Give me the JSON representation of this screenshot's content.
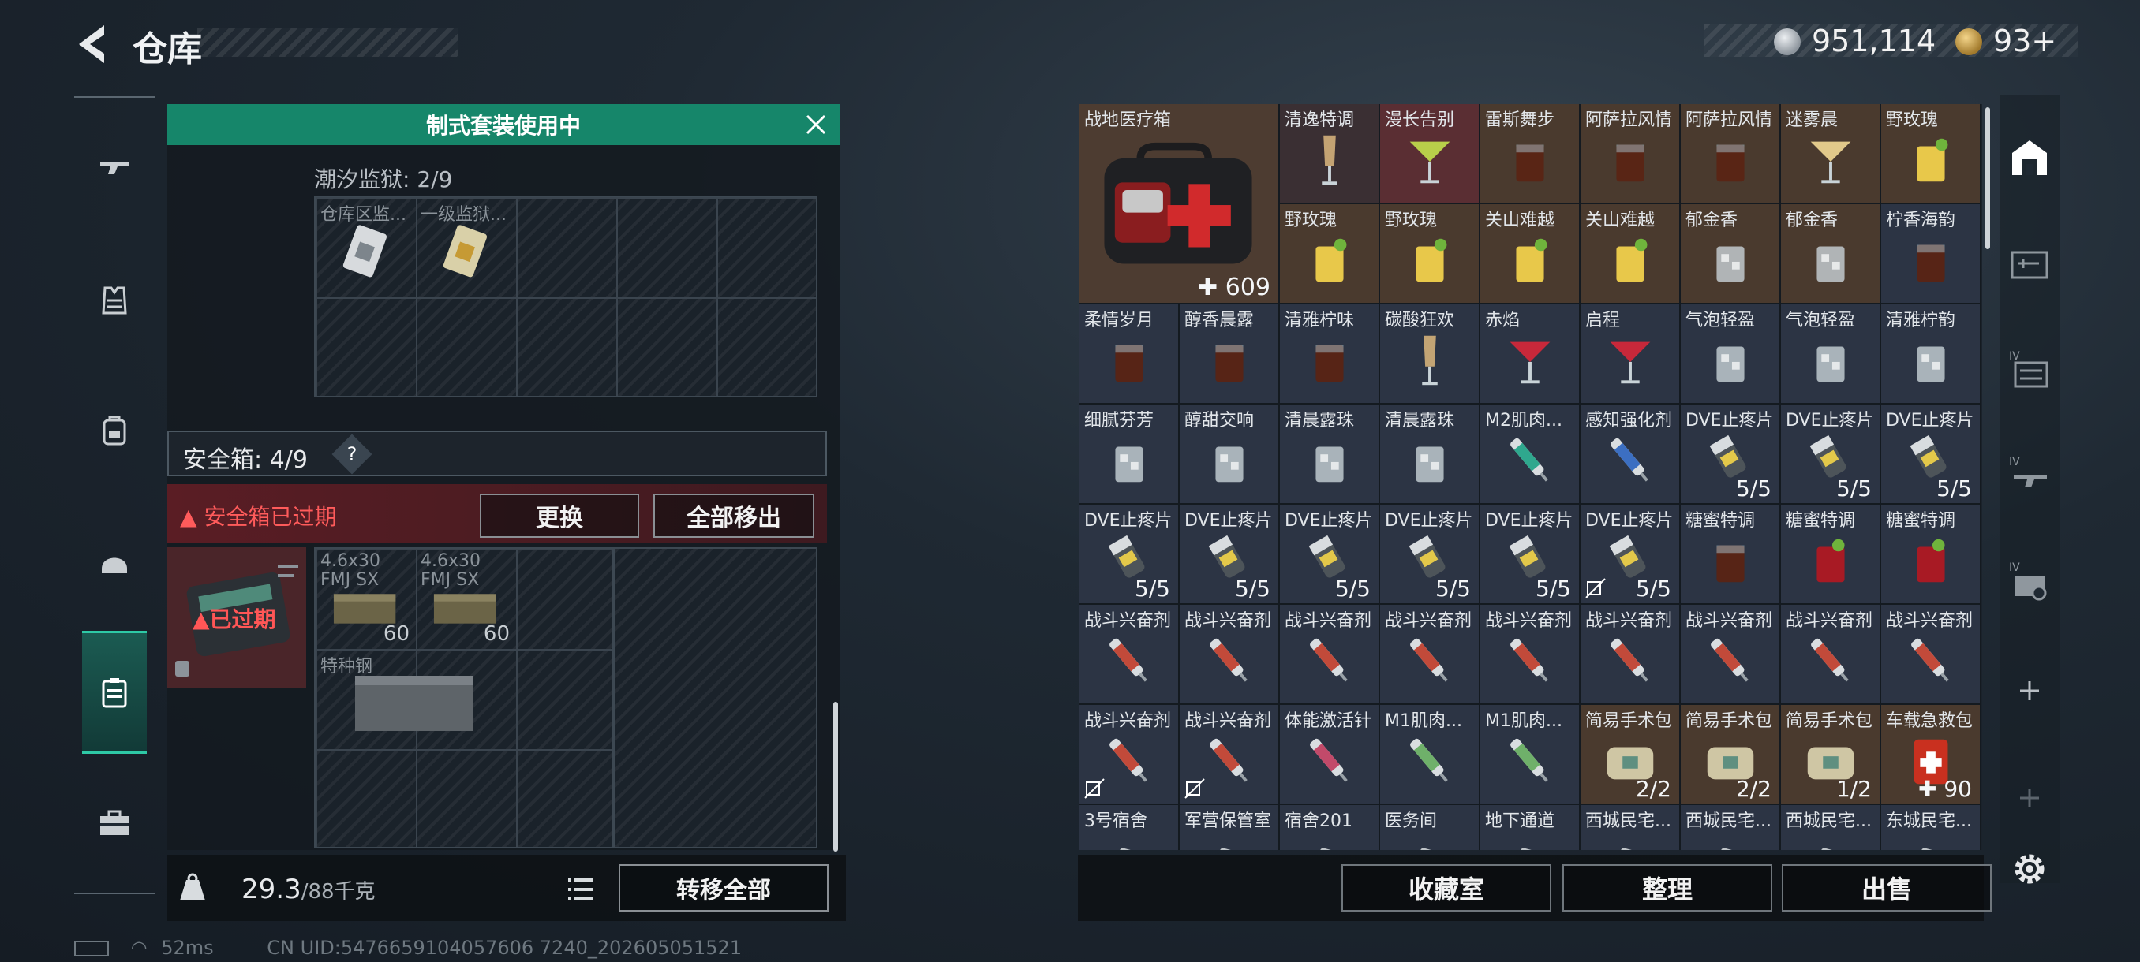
{
  "header": {
    "title": "仓库",
    "currency_silver": "951,114",
    "currency_gold": "93+"
  },
  "left_nav": [
    "gun-icon",
    "armor-vest-icon",
    "backpack-icon",
    "helmet-icon",
    "safebox-icon",
    "toolbox-icon"
  ],
  "kit": {
    "banner": "制式套装使用中",
    "container_label": "潮汐监狱: 2/9",
    "items": [
      {
        "name": "仓库区监...",
        "icon": "keycard-icon"
      },
      {
        "name": "一级监狱...",
        "icon": "keycard-icon"
      }
    ]
  },
  "safebox": {
    "label": "安全箱: 4/9",
    "help": "?",
    "expired_warning": "安全箱已过期",
    "replace_button": "更换",
    "move_all_button": "全部移出",
    "case_status": "已过期",
    "items": [
      {
        "name": "4.6x30 FMJ SX",
        "count": "60"
      },
      {
        "name": "4.6x30 FMJ SX",
        "count": "60"
      },
      {
        "name": "特种钢",
        "count": ""
      }
    ]
  },
  "footer_left": {
    "weight": "29.3",
    "weight_max": "/88千克",
    "transfer_all": "转移全部"
  },
  "inventory": {
    "featured": {
      "name": "战地医疗箱",
      "count": "609"
    },
    "cells": [
      {
        "name": "清逸特调",
        "count": "",
        "color": "#3a2f33",
        "kind": "champagne"
      },
      {
        "name": "漫长告别",
        "count": "",
        "color": "#5a2e33",
        "kind": "martini"
      },
      {
        "name": "雷斯舞步",
        "count": "",
        "color": "#4a3a2e",
        "kind": "cola"
      },
      {
        "name": "阿萨拉风情",
        "count": "",
        "color": "#4a3a2e",
        "kind": "cola"
      },
      {
        "name": "阿萨拉风情",
        "count": "",
        "color": "#4a3a2e",
        "kind": "cola"
      },
      {
        "name": "迷雾晨",
        "count": "",
        "color": "#4a3a2e",
        "kind": "coupe"
      },
      {
        "name": "野玫瑰",
        "count": "",
        "color": "#4a3a2e",
        "kind": "yellow"
      },
      {
        "name": "野玫瑰",
        "count": "",
        "color": "#4a3a2e",
        "kind": "yellow"
      },
      {
        "name": "野玫瑰",
        "count": "",
        "color": "#4a3a2e",
        "kind": "yellow"
      },
      {
        "name": "关山难越",
        "count": "",
        "color": "#4a3a2e",
        "kind": "yellow"
      },
      {
        "name": "关山难越",
        "count": "",
        "color": "#4a3a2e",
        "kind": "yellow"
      },
      {
        "name": "郁金香",
        "count": "",
        "color": "#4a3a2e",
        "kind": "clear"
      },
      {
        "name": "郁金香",
        "count": "",
        "color": "#4a3a2e",
        "kind": "clear"
      },
      {
        "name": "柠香海韵",
        "count": "",
        "color": "#2c3444",
        "kind": "cola"
      },
      {
        "name": "柔情岁月",
        "count": "",
        "color": "#2c3444",
        "kind": "whisky"
      },
      {
        "name": "醇香晨露",
        "count": "",
        "color": "#2c3444",
        "kind": "whisky"
      },
      {
        "name": "清雅柠味",
        "count": "",
        "color": "#2c3444",
        "kind": "whisky"
      },
      {
        "name": "碳酸狂欢",
        "count": "",
        "color": "#2c3444",
        "kind": "champagne"
      },
      {
        "name": "赤焰",
        "count": "",
        "color": "#2c3444",
        "kind": "martini-red"
      },
      {
        "name": "启程",
        "count": "",
        "color": "#2c3444",
        "kind": "martini-red"
      },
      {
        "name": "气泡轻盈",
        "count": "",
        "color": "#2c3444",
        "kind": "ice"
      },
      {
        "name": "气泡轻盈",
        "count": "",
        "color": "#2c3444",
        "kind": "ice"
      },
      {
        "name": "清雅柠韵",
        "count": "",
        "color": "#2c3444",
        "kind": "ice"
      },
      {
        "name": "细腻芬芳",
        "count": "",
        "color": "#2c3444",
        "kind": "ice"
      },
      {
        "name": "醇甜交响",
        "count": "",
        "color": "#2c3444",
        "kind": "ice"
      },
      {
        "name": "清晨露珠",
        "count": "",
        "color": "#2c3444",
        "kind": "ice"
      },
      {
        "name": "清晨露珠",
        "count": "",
        "color": "#2c3444",
        "kind": "ice"
      },
      {
        "name": "M2肌肉...",
        "count": "",
        "color": "#2c3444",
        "kind": "syringe-teal"
      },
      {
        "name": "感知强化剂",
        "count": "",
        "color": "#2c3444",
        "kind": "syringe-blue"
      },
      {
        "name": "DVE止疼片",
        "count": "5/5",
        "color": "#2c3444",
        "kind": "pills"
      },
      {
        "name": "DVE止疼片",
        "count": "5/5",
        "color": "#2c3444",
        "kind": "pills"
      },
      {
        "name": "DVE止疼片",
        "count": "5/5",
        "color": "#2c3444",
        "kind": "pills"
      },
      {
        "name": "DVE止疼片",
        "count": "5/5",
        "color": "#2c3444",
        "kind": "pills"
      },
      {
        "name": "DVE止疼片",
        "count": "5/5",
        "color": "#2c3444",
        "kind": "pills"
      },
      {
        "name": "DVE止疼片",
        "count": "5/5",
        "color": "#2c3444",
        "kind": "pills"
      },
      {
        "name": "DVE止疼片",
        "count": "5/5",
        "color": "#2c3444",
        "kind": "pills"
      },
      {
        "name": "DVE止疼片",
        "count": "5/5",
        "color": "#2c3444",
        "kind": "pills"
      },
      {
        "name": "DVE止疼片",
        "count": "5/5",
        "color": "#2c3444",
        "kind": "pills",
        "locked": true
      },
      {
        "name": "糖蜜特调",
        "count": "",
        "color": "#2c3444",
        "kind": "whisky"
      },
      {
        "name": "糖蜜特调",
        "count": "",
        "color": "#2c3444",
        "kind": "ice-red"
      },
      {
        "name": "糖蜜特调",
        "count": "",
        "color": "#2c3444",
        "kind": "ice-red"
      },
      {
        "name": "战斗兴奋剂",
        "count": "",
        "color": "#2c3444",
        "kind": "syringe-red"
      },
      {
        "name": "战斗兴奋剂",
        "count": "",
        "color": "#2c3444",
        "kind": "syringe-red"
      },
      {
        "name": "战斗兴奋剂",
        "count": "",
        "color": "#2c3444",
        "kind": "syringe-red"
      },
      {
        "name": "战斗兴奋剂",
        "count": "",
        "color": "#2c3444",
        "kind": "syringe-red"
      },
      {
        "name": "战斗兴奋剂",
        "count": "",
        "color": "#2c3444",
        "kind": "syringe-red"
      },
      {
        "name": "战斗兴奋剂",
        "count": "",
        "color": "#2c3444",
        "kind": "syringe-red"
      },
      {
        "name": "战斗兴奋剂",
        "count": "",
        "color": "#2c3444",
        "kind": "syringe-red"
      },
      {
        "name": "战斗兴奋剂",
        "count": "",
        "color": "#2c3444",
        "kind": "syringe-red"
      },
      {
        "name": "战斗兴奋剂",
        "count": "",
        "color": "#2c3444",
        "kind": "syringe-red"
      },
      {
        "name": "战斗兴奋剂",
        "count": "",
        "color": "#2c3444",
        "kind": "syringe-red",
        "locked": true
      },
      {
        "name": "战斗兴奋剂",
        "count": "",
        "color": "#2c3444",
        "kind": "syringe-red",
        "locked": true
      },
      {
        "name": "体能激活针",
        "count": "",
        "color": "#2c3444",
        "kind": "syringe-pink"
      },
      {
        "name": "M1肌肉...",
        "count": "",
        "color": "#2c3444",
        "kind": "syringe-green"
      },
      {
        "name": "M1肌肉...",
        "count": "",
        "color": "#2c3444",
        "kind": "syringe-green"
      },
      {
        "name": "简易手术包",
        "count": "2/2",
        "color": "#4a3a2e",
        "kind": "surgery"
      },
      {
        "name": "简易手术包",
        "count": "2/2",
        "color": "#4a3a2e",
        "kind": "surgery"
      },
      {
        "name": "简易手术包",
        "count": "1/2",
        "color": "#4a3a2e",
        "kind": "surgery"
      },
      {
        "name": "车载急救包",
        "count": "90",
        "color": "#4a3a2e",
        "kind": "redbag"
      },
      {
        "name": "3号宿舍",
        "count": "",
        "color": "#2c3444",
        "kind": "keycard"
      },
      {
        "name": "军营保管室",
        "count": "",
        "color": "#2c3444",
        "kind": "keycard"
      },
      {
        "name": "宿舍201",
        "count": "",
        "color": "#2c3444",
        "kind": "keycard"
      },
      {
        "name": "医务间",
        "count": "",
        "color": "#2c3444",
        "kind": "keycard"
      },
      {
        "name": "地下通道",
        "count": "",
        "color": "#2c3444",
        "kind": "keycard"
      },
      {
        "name": "西城民宅...",
        "count": "",
        "color": "#2c3444",
        "kind": "keycard"
      },
      {
        "name": "西城民宅...",
        "count": "",
        "color": "#2c3444",
        "kind": "keycard"
      },
      {
        "name": "西城民宅...",
        "count": "",
        "color": "#2c3444",
        "kind": "keycard"
      },
      {
        "name": "东城民宅...",
        "count": "",
        "color": "#2c3444",
        "kind": "keycard"
      }
    ]
  },
  "footer_right": {
    "collection": "收藏室",
    "sort": "整理",
    "sell": "出售"
  },
  "right_nav": [
    "storage-icon",
    "weapon-case-icon",
    "iv-case-icon",
    "iv-gun-case-icon",
    "iv-gear-case-icon",
    "add-icon",
    "add-icon",
    "settings-icon"
  ],
  "status": {
    "ping": "52ms",
    "uid": "CN UID:5476659104057606 7240_202605051521"
  },
  "colors": {
    "accent": "#16866a",
    "danger": "#ff5b5b"
  }
}
